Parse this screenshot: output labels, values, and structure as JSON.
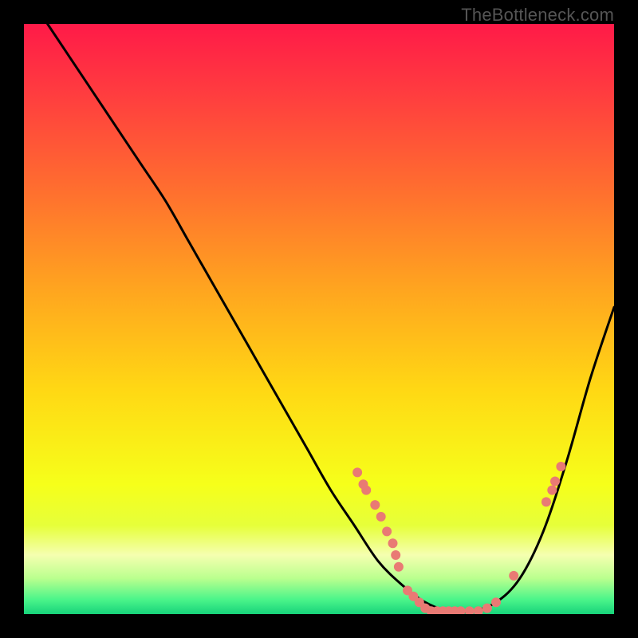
{
  "watermark": "TheBottleneck.com",
  "chart_data": {
    "type": "line",
    "title": "",
    "xlabel": "",
    "ylabel": "",
    "xlim": [
      0,
      100
    ],
    "ylim": [
      0,
      100
    ],
    "note": "Axes are unitless percentages; values estimated from pixel positions.",
    "gradient_stops": [
      {
        "offset": 0.0,
        "color": "#ff1a48"
      },
      {
        "offset": 0.12,
        "color": "#ff3d3f"
      },
      {
        "offset": 0.28,
        "color": "#ff6e2f"
      },
      {
        "offset": 0.45,
        "color": "#ffa51f"
      },
      {
        "offset": 0.62,
        "color": "#ffd814"
      },
      {
        "offset": 0.78,
        "color": "#f6ff1a"
      },
      {
        "offset": 0.85,
        "color": "#e6ff3a"
      },
      {
        "offset": 0.9,
        "color": "#f5ffb0"
      },
      {
        "offset": 0.94,
        "color": "#b9ff8e"
      },
      {
        "offset": 0.975,
        "color": "#4cf58a"
      },
      {
        "offset": 1.0,
        "color": "#17d37b"
      }
    ],
    "series": [
      {
        "name": "bottleneck-curve",
        "x": [
          4,
          8,
          12,
          16,
          20,
          24,
          28,
          32,
          36,
          40,
          44,
          48,
          52,
          56,
          60,
          64,
          68,
          72,
          76,
          80,
          84,
          88,
          92,
          96,
          100
        ],
        "y": [
          100,
          94,
          88,
          82,
          76,
          70,
          63,
          56,
          49,
          42,
          35,
          28,
          21,
          15,
          9,
          5,
          2,
          0.5,
          0.5,
          2,
          6,
          14,
          26,
          40,
          52
        ]
      }
    ],
    "markers": {
      "name": "highlight-points",
      "color": "#e97a74",
      "radius_px": 6,
      "points": [
        {
          "x": 56.5,
          "y": 24.0
        },
        {
          "x": 57.5,
          "y": 22.0
        },
        {
          "x": 58.0,
          "y": 21.0
        },
        {
          "x": 59.5,
          "y": 18.5
        },
        {
          "x": 60.5,
          "y": 16.5
        },
        {
          "x": 61.5,
          "y": 14.0
        },
        {
          "x": 62.5,
          "y": 12.0
        },
        {
          "x": 63.0,
          "y": 10.0
        },
        {
          "x": 63.5,
          "y": 8.0
        },
        {
          "x": 65.0,
          "y": 4.0
        },
        {
          "x": 66.0,
          "y": 3.0
        },
        {
          "x": 67.0,
          "y": 2.0
        },
        {
          "x": 68.0,
          "y": 1.0
        },
        {
          "x": 69.0,
          "y": 0.5
        },
        {
          "x": 70.0,
          "y": 0.5
        },
        {
          "x": 71.0,
          "y": 0.5
        },
        {
          "x": 72.0,
          "y": 0.5
        },
        {
          "x": 73.0,
          "y": 0.5
        },
        {
          "x": 74.0,
          "y": 0.5
        },
        {
          "x": 75.5,
          "y": 0.5
        },
        {
          "x": 77.0,
          "y": 0.5
        },
        {
          "x": 78.5,
          "y": 1.0
        },
        {
          "x": 80.0,
          "y": 2.0
        },
        {
          "x": 83.0,
          "y": 6.5
        },
        {
          "x": 88.5,
          "y": 19.0
        },
        {
          "x": 89.5,
          "y": 21.0
        },
        {
          "x": 90.0,
          "y": 22.5
        },
        {
          "x": 91.0,
          "y": 25.0
        }
      ]
    }
  }
}
